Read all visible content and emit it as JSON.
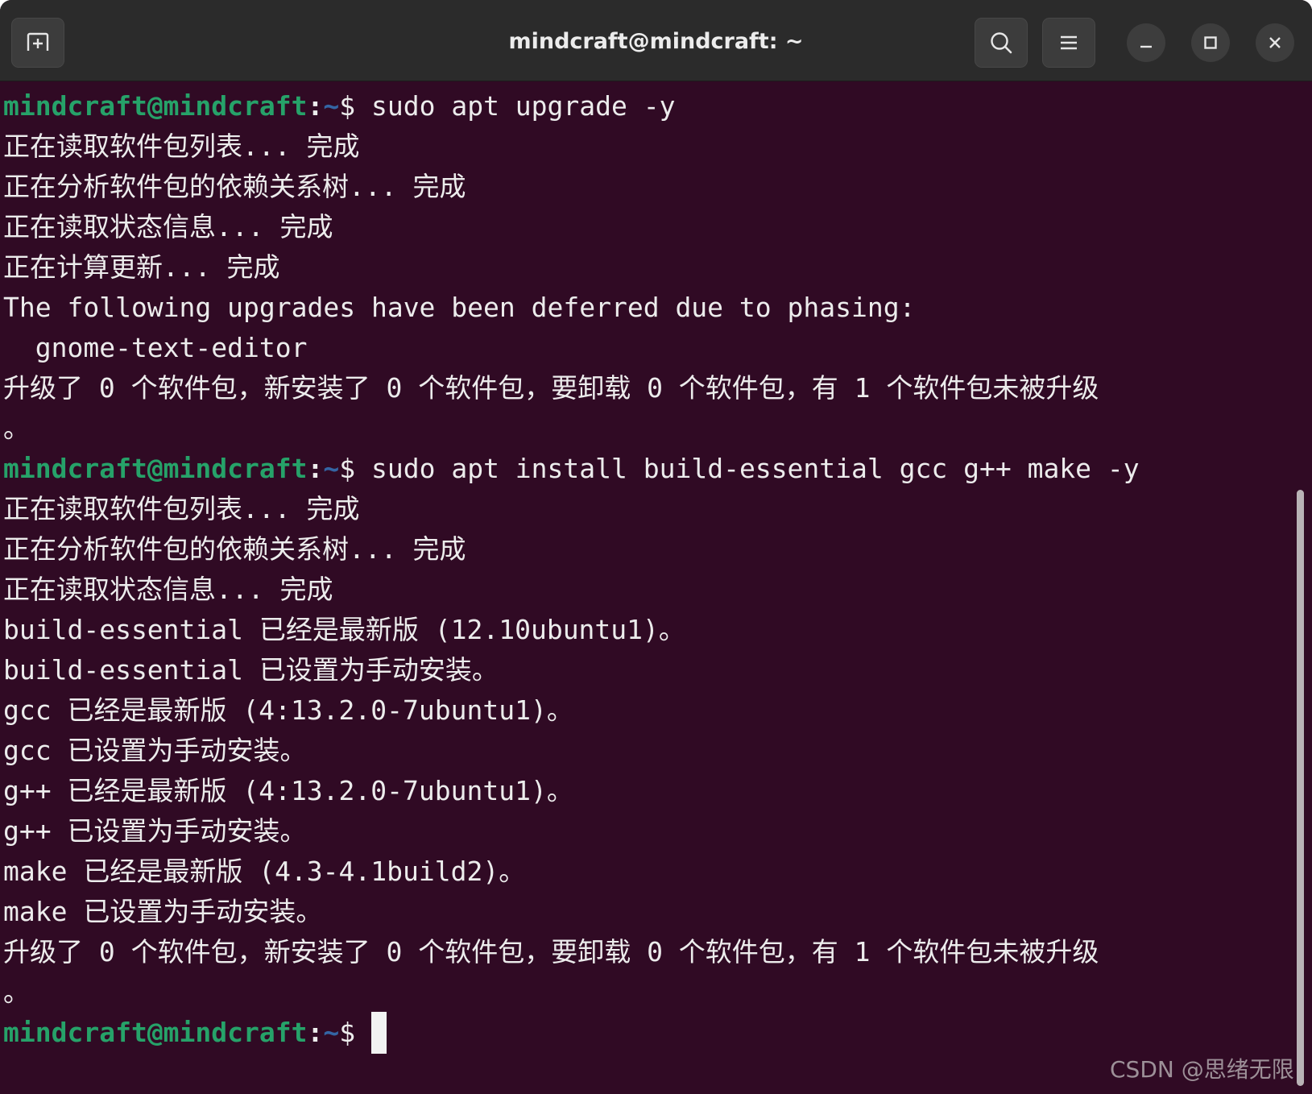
{
  "window": {
    "title": "mindcraft@mindcraft: ~",
    "buttons": {
      "new_tab": "new-tab-icon",
      "search": "search-icon",
      "menu": "hamburger-menu-icon",
      "minimize": "minimize-icon",
      "maximize": "maximize-icon",
      "close": "close-icon"
    }
  },
  "prompt": {
    "user_host": "mindcraft@mindcraft",
    "colon": ":",
    "path": "~",
    "symbol": "$ "
  },
  "terminal": {
    "lines": [
      "sudo apt upgrade -y",
      "正在读取软件包列表... 完成",
      "正在分析软件包的依赖关系树... 完成",
      "正在读取状态信息... 完成",
      "正在计算更新... 完成",
      "The following upgrades have been deferred due to phasing:",
      "  gnome-text-editor",
      "升级了 0 个软件包，新安装了 0 个软件包，要卸载 0 个软件包，有 1 个软件包未被升级",
      "。",
      "sudo apt install build-essential gcc g++ make -y",
      "正在读取软件包列表... 完成",
      "正在分析软件包的依赖关系树... 完成",
      "正在读取状态信息... 完成",
      "build-essential 已经是最新版 (12.10ubuntu1)。",
      "build-essential 已设置为手动安装。",
      "gcc 已经是最新版 (4:13.2.0-7ubuntu1)。",
      "gcc 已设置为手动安装。",
      "g++ 已经是最新版 (4:13.2.0-7ubuntu1)。",
      "g++ 已设置为手动安装。",
      "make 已经是最新版 (4.3-4.1build2)。",
      "make 已设置为手动安装。",
      "升级了 0 个软件包，新安装了 0 个软件包，要卸载 0 个软件包，有 1 个软件包未被升级",
      "。"
    ]
  },
  "watermark": "CSDN @思绪无限",
  "colors": {
    "terminal_bg": "#300a24",
    "prompt_user": "#26a269",
    "prompt_path": "#3465a4",
    "text": "#ececec"
  }
}
